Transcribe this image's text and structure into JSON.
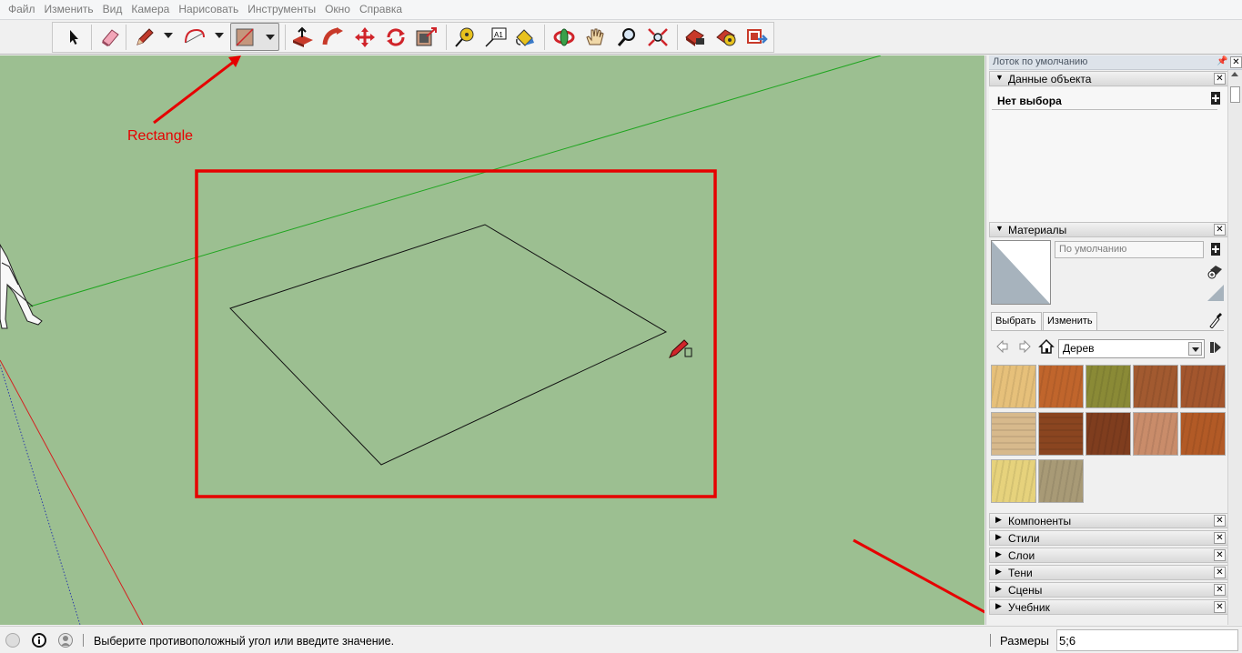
{
  "menu": [
    "Файл",
    "Изменить",
    "Вид",
    "Камера",
    "Нарисовать",
    "Инструменты",
    "Окно",
    "Справка"
  ],
  "toolbar": {
    "tools": [
      "select-tool",
      "eraser-tool",
      "pencil-tool",
      "arc-tool",
      "rectangle-tool",
      "push-pull-tool",
      "follow-me-tool",
      "move-tool",
      "rotate-tool",
      "offset-tool",
      "tape-measure-tool",
      "text-tool",
      "paint-bucket-tool",
      "orbit-tool",
      "pan-tool",
      "zoom-tool",
      "zoom-extents-tool",
      "warehouse-tool",
      "extension-tool",
      "share-tool"
    ],
    "active_tool": "rectangle-tool",
    "text_tool_label": "A1"
  },
  "annotation": {
    "label": "Rectangle",
    "color": "#e60000"
  },
  "viewport": {
    "background": "#9cbf91"
  },
  "tray": {
    "title": "Лоток по умолчанию",
    "panels": {
      "entity_info": {
        "title": "Данные объекта",
        "state": "Нет выбора"
      },
      "materials": {
        "title": "Материалы",
        "current": "По умолчанию",
        "tabs": [
          "Выбрать",
          "Изменить"
        ],
        "library": "Дерев",
        "swatch_colors": [
          "#e6c07a",
          "#c0652c",
          "#8a8a36",
          "#a25a30",
          "#a3562d",
          "#d7b98c",
          "#8a4520",
          "#7f3d1e",
          "#c98c6a",
          "#b25a26",
          "#e6d27c",
          "#a89a76"
        ]
      },
      "collapsed": [
        "Компоненты",
        "Стили",
        "Слои",
        "Тени",
        "Сцены",
        "Учебник"
      ]
    }
  },
  "status": {
    "message": "Выберите противоположный угол или введите значение.",
    "measure_label": "Размеры",
    "measure_value": "5;6"
  }
}
